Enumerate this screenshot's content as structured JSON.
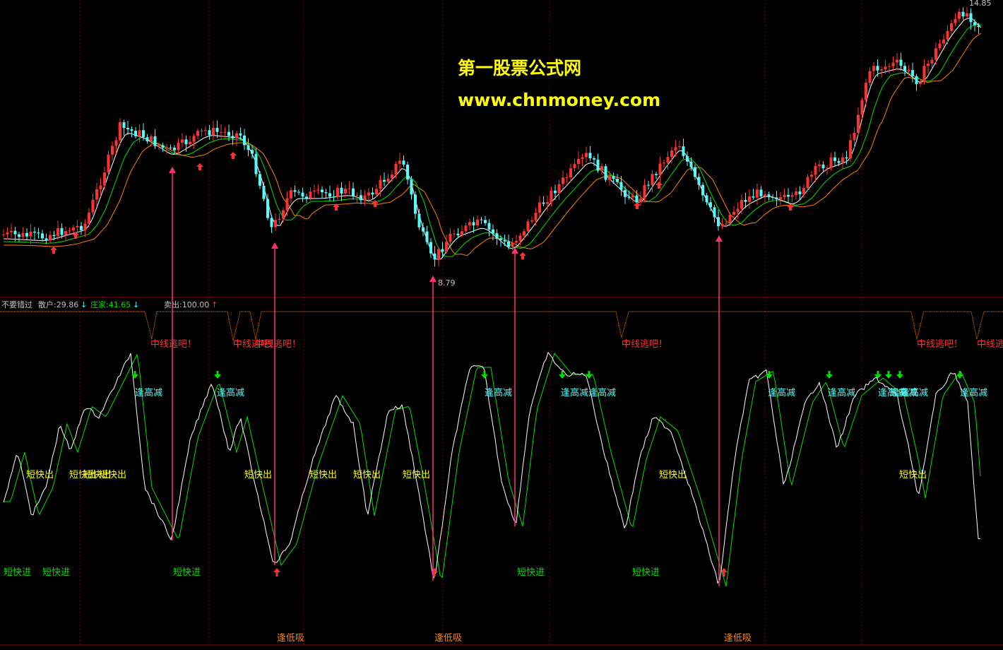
{
  "watermark": {
    "title": "第一股票公式网",
    "url": "www.chnmoney.com",
    "color": "#ffff00"
  },
  "price_panel": {
    "high_label": "14.85",
    "low_label": "8.79"
  },
  "indicator_header": {
    "name": "不要错过",
    "retail_label": "散户:29.86",
    "retail_arrow": "↓",
    "dealer_label": "庄家:41.65",
    "dealer_arrow": "↓",
    "sell_label": "卖出:100.00",
    "sell_arrow": "↑"
  },
  "signals": {
    "mid_escape": "中线逃吧！",
    "top_reduce": "逢高减",
    "short_out": "短快出",
    "short_in": "短快进",
    "low_buy": "逢低吸"
  },
  "colors": {
    "bull": "#ff3232",
    "bear": "#54fcfc",
    "ma_white": "#ffffff",
    "ma_green": "#00e000",
    "ma_orange": "#ff8000",
    "arrow_red": "#ff3070",
    "divider": "#a00000",
    "grid": "#800000"
  },
  "icons": {
    "up_arrow": "red-up-arrow-icon",
    "down_arrow": "green-down-arrow-icon",
    "vertical_marker": "magenta-arrow-icon"
  }
}
